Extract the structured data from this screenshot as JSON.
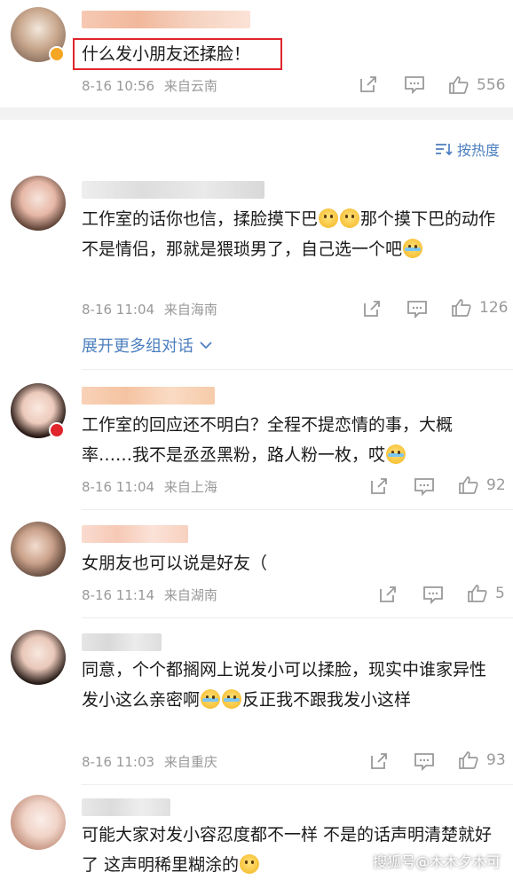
{
  "post": {
    "text": "什么发小朋友还揉脸！",
    "date": "8-16 10:56",
    "location": "来自云南",
    "likes": "556"
  },
  "sort": {
    "label": "按热度",
    "icon": "sort-icon"
  },
  "comments": [
    {
      "text_parts": [
        "工作室的话你也信，揉脸摸下巴",
        "那个摸下巴的动作不是情侣，那就是猥琐男了，自己选一个吧"
      ],
      "date": "8-16 11:04",
      "location": "来自海南",
      "likes": "126",
      "expand": "展开更多组对话"
    },
    {
      "text_parts": [
        "工作室的回应还不明白？全程不提恋情的事，大概率……我不是丞丞黑粉，路人粉一枚，哎"
      ],
      "date": "8-16 11:04",
      "location": "来自上海",
      "likes": "92"
    },
    {
      "text_parts": [
        "女朋友也可以说是好友（"
      ],
      "date": "8-16 11:14",
      "location": "来自湖南",
      "likes": "5"
    },
    {
      "text_parts": [
        "同意，个个都搁网上说发小可以揉脸，现实中谁家异性发小这么亲密啊",
        "反正我不跟我发小这样"
      ],
      "date": "8-16 11:03",
      "location": "来自重庆",
      "likes": "93"
    },
    {
      "text_parts": [
        "可能大家对发小容忍度都不一样 不是的话声明清楚就好了 这声明稀里糊涂的"
      ]
    }
  ],
  "watermark": "搜狐号@木木夕木可",
  "colors": {
    "accent": "#4c7fbf",
    "highlight": "#e0252d",
    "meta": "#999999"
  }
}
